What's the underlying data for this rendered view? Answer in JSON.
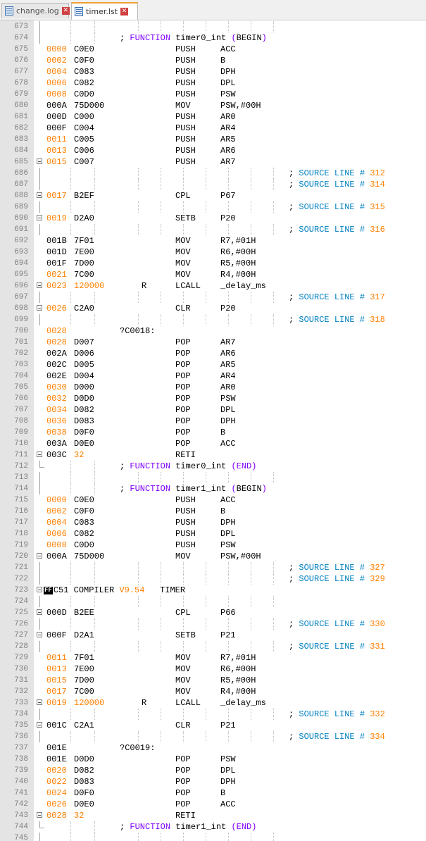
{
  "tabs": [
    {
      "label": "change.log",
      "active": false
    },
    {
      "label": "timer.lst",
      "active": true
    }
  ],
  "lines": [
    {
      "n": "673"
    },
    {
      "n": "674",
      "cmt_func": {
        "pre": "; ",
        "kw": "FUNCTION",
        "name": " timer0_int ",
        "paren": "(",
        "tag": "BEGIN",
        ")": ")"
      }
    },
    {
      "n": "675",
      "addr": "0000",
      "bytes": "C0E0",
      "mn": "PUSH",
      "op": "ACC",
      "addr_c": "orange"
    },
    {
      "n": "676",
      "addr": "0002",
      "bytes": "C0F0",
      "mn": "PUSH",
      "op": "B",
      "addr_c": "orange"
    },
    {
      "n": "677",
      "addr": "0004",
      "bytes": "C083",
      "mn": "PUSH",
      "op": "DPH",
      "addr_c": "orange"
    },
    {
      "n": "678",
      "addr": "0006",
      "bytes": "C082",
      "mn": "PUSH",
      "op": "DPL",
      "addr_c": "orange"
    },
    {
      "n": "679",
      "addr": "0008",
      "bytes": "C0D0",
      "mn": "PUSH",
      "op": "PSW",
      "addr_c": "orange"
    },
    {
      "n": "680",
      "addr": "000A",
      "bytes": "75D000",
      "mn": "MOV",
      "op": "PSW,#00H",
      "addr_c": "black"
    },
    {
      "n": "681",
      "addr": "000D",
      "bytes": "C000",
      "mn": "PUSH",
      "op": "AR0",
      "addr_c": "black"
    },
    {
      "n": "682",
      "addr": "000F",
      "bytes": "C004",
      "mn": "PUSH",
      "op": "AR4",
      "addr_c": "black"
    },
    {
      "n": "683",
      "addr": "0011",
      "bytes": "C005",
      "mn": "PUSH",
      "op": "AR5",
      "addr_c": "orange"
    },
    {
      "n": "684",
      "addr": "0013",
      "bytes": "C006",
      "mn": "PUSH",
      "op": "AR6",
      "addr_c": "orange"
    },
    {
      "n": "685",
      "addr": "0015",
      "bytes": "C007",
      "mn": "PUSH",
      "op": "AR7",
      "addr_c": "orange",
      "fold": true
    },
    {
      "n": "686",
      "src": "312"
    },
    {
      "n": "687",
      "src": "314"
    },
    {
      "n": "688",
      "addr": "0017",
      "bytes": "B2EF",
      "mn": "CPL",
      "op": "P67",
      "addr_c": "orange",
      "fold": true
    },
    {
      "n": "689",
      "src": "315"
    },
    {
      "n": "690",
      "addr": "0019",
      "bytes": "D2A0",
      "mn": "SETB",
      "op": "P20",
      "addr_c": "orange",
      "fold": true
    },
    {
      "n": "691",
      "src": "316"
    },
    {
      "n": "692",
      "addr": "001B",
      "bytes": "7F01",
      "mn": "MOV",
      "op": "R7,#01H",
      "addr_c": "black"
    },
    {
      "n": "693",
      "addr": "001D",
      "bytes": "7E00",
      "mn": "MOV",
      "op": "R6,#00H",
      "addr_c": "black"
    },
    {
      "n": "694",
      "addr": "001F",
      "bytes": "7D00",
      "mn": "MOV",
      "op": "R5,#00H",
      "addr_c": "black"
    },
    {
      "n": "695",
      "addr": "0021",
      "bytes": "7C00",
      "mn": "MOV",
      "op": "R4,#00H",
      "addr_c": "orange"
    },
    {
      "n": "696",
      "addr": "0023",
      "bytes": "120000",
      "rel": "R",
      "mn": "LCALL",
      "op": "_delay_ms",
      "addr_c": "orange",
      "fold": true,
      "bytes_c": "orange"
    },
    {
      "n": "697",
      "src": "317"
    },
    {
      "n": "698",
      "addr": "0026",
      "bytes": "C2A0",
      "mn": "CLR",
      "op": "P20",
      "addr_c": "orange",
      "fold": true
    },
    {
      "n": "699",
      "src": "318"
    },
    {
      "n": "700",
      "addr": "0028",
      "labeltxt": "?C0018:",
      "addr_c": "orange"
    },
    {
      "n": "701",
      "addr": "0028",
      "bytes": "D007",
      "mn": "POP",
      "op": "AR7",
      "addr_c": "orange"
    },
    {
      "n": "702",
      "addr": "002A",
      "bytes": "D006",
      "mn": "POP",
      "op": "AR6",
      "addr_c": "black"
    },
    {
      "n": "703",
      "addr": "002C",
      "bytes": "D005",
      "mn": "POP",
      "op": "AR5",
      "addr_c": "black"
    },
    {
      "n": "704",
      "addr": "002E",
      "bytes": "D004",
      "mn": "POP",
      "op": "AR4",
      "addr_c": "black"
    },
    {
      "n": "705",
      "addr": "0030",
      "bytes": "D000",
      "mn": "POP",
      "op": "AR0",
      "addr_c": "orange"
    },
    {
      "n": "706",
      "addr": "0032",
      "bytes": "D0D0",
      "mn": "POP",
      "op": "PSW",
      "addr_c": "orange"
    },
    {
      "n": "707",
      "addr": "0034",
      "bytes": "D082",
      "mn": "POP",
      "op": "DPL",
      "addr_c": "orange"
    },
    {
      "n": "708",
      "addr": "0036",
      "bytes": "D083",
      "mn": "POP",
      "op": "DPH",
      "addr_c": "orange"
    },
    {
      "n": "709",
      "addr": "0038",
      "bytes": "D0F0",
      "mn": "POP",
      "op": "B",
      "addr_c": "orange"
    },
    {
      "n": "710",
      "addr": "003A",
      "bytes": "D0E0",
      "mn": "POP",
      "op": "ACC",
      "addr_c": "black"
    },
    {
      "n": "711",
      "addr": "003C",
      "bytes": "32",
      "mn": "RETI",
      "addr_c": "black",
      "fold": true,
      "bytes_c": "orange"
    },
    {
      "n": "712",
      "cmt_func": {
        "pre": "; ",
        "kw": "FUNCTION",
        "name": " timer0_int ",
        "paren": "(",
        "tag": "END",
        ")": ")"
      }
    },
    {
      "n": "713"
    },
    {
      "n": "714",
      "cmt_func": {
        "pre": "; ",
        "kw": "FUNCTION",
        "name": " timer1_int ",
        "paren": "(",
        "tag": "BEGIN",
        ")": ")"
      }
    },
    {
      "n": "715",
      "addr": "0000",
      "bytes": "C0E0",
      "mn": "PUSH",
      "op": "ACC",
      "addr_c": "orange"
    },
    {
      "n": "716",
      "addr": "0002",
      "bytes": "C0F0",
      "mn": "PUSH",
      "op": "B",
      "addr_c": "orange"
    },
    {
      "n": "717",
      "addr": "0004",
      "bytes": "C083",
      "mn": "PUSH",
      "op": "DPH",
      "addr_c": "orange"
    },
    {
      "n": "718",
      "addr": "0006",
      "bytes": "C082",
      "mn": "PUSH",
      "op": "DPL",
      "addr_c": "orange"
    },
    {
      "n": "719",
      "addr": "0008",
      "bytes": "C0D0",
      "mn": "PUSH",
      "op": "PSW",
      "addr_c": "orange"
    },
    {
      "n": "720",
      "addr": "000A",
      "bytes": "75D000",
      "mn": "MOV",
      "op": "PSW,#00H",
      "addr_c": "black",
      "fold": true
    },
    {
      "n": "721",
      "src": "327"
    },
    {
      "n": "722",
      "src": "329"
    },
    {
      "n": "723",
      "compiler": {
        "badge": "FF",
        "pre": "C51 COMPILER ",
        "ver": "V9.54",
        "post": "   TIMER"
      },
      "fold": true
    },
    {
      "n": "724"
    },
    {
      "n": "725",
      "addr": "000D",
      "bytes": "B2EE",
      "mn": "CPL",
      "op": "P66",
      "addr_c": "black",
      "fold": true
    },
    {
      "n": "726",
      "src": "330"
    },
    {
      "n": "727",
      "addr": "000F",
      "bytes": "D2A1",
      "mn": "SETB",
      "op": "P21",
      "addr_c": "black",
      "fold": true
    },
    {
      "n": "728",
      "src": "331"
    },
    {
      "n": "729",
      "addr": "0011",
      "bytes": "7F01",
      "mn": "MOV",
      "op": "R7,#01H",
      "addr_c": "orange"
    },
    {
      "n": "730",
      "addr": "0013",
      "bytes": "7E00",
      "mn": "MOV",
      "op": "R6,#00H",
      "addr_c": "orange"
    },
    {
      "n": "731",
      "addr": "0015",
      "bytes": "7D00",
      "mn": "MOV",
      "op": "R5,#00H",
      "addr_c": "orange"
    },
    {
      "n": "732",
      "addr": "0017",
      "bytes": "7C00",
      "mn": "MOV",
      "op": "R4,#00H",
      "addr_c": "orange"
    },
    {
      "n": "733",
      "addr": "0019",
      "bytes": "120000",
      "rel": "R",
      "mn": "LCALL",
      "op": "_delay_ms",
      "addr_c": "orange",
      "fold": true,
      "bytes_c": "orange"
    },
    {
      "n": "734",
      "src": "332"
    },
    {
      "n": "735",
      "addr": "001C",
      "bytes": "C2A1",
      "mn": "CLR",
      "op": "P21",
      "addr_c": "black",
      "fold": true
    },
    {
      "n": "736",
      "src": "334"
    },
    {
      "n": "737",
      "addr": "001E",
      "labeltxt": "?C0019:",
      "addr_c": "black"
    },
    {
      "n": "738",
      "addr": "001E",
      "bytes": "D0D0",
      "mn": "POP",
      "op": "PSW",
      "addr_c": "black"
    },
    {
      "n": "739",
      "addr": "0020",
      "bytes": "D082",
      "mn": "POP",
      "op": "DPL",
      "addr_c": "orange"
    },
    {
      "n": "740",
      "addr": "0022",
      "bytes": "D083",
      "mn": "POP",
      "op": "DPH",
      "addr_c": "orange"
    },
    {
      "n": "741",
      "addr": "0024",
      "bytes": "D0F0",
      "mn": "POP",
      "op": "B",
      "addr_c": "orange"
    },
    {
      "n": "742",
      "addr": "0026",
      "bytes": "D0E0",
      "mn": "POP",
      "op": "ACC",
      "addr_c": "orange"
    },
    {
      "n": "743",
      "addr": "0028",
      "bytes": "32",
      "mn": "RETI",
      "addr_c": "orange",
      "fold": true,
      "bytes_c": "orange"
    },
    {
      "n": "744",
      "cmt_func": {
        "pre": "; ",
        "kw": "FUNCTION",
        "name": " timer1_int ",
        "paren": "(",
        "tag": "END",
        ")": ")"
      }
    },
    {
      "n": "745"
    }
  ],
  "source_line_text": {
    "pre": "; ",
    "kw": "SOURCE LINE",
    "hash": " # "
  },
  "colors": {
    "address": "#ff8000",
    "keyword": "#8000ff",
    "comment": "#0080c0",
    "gutter": "#e4e4e4"
  }
}
